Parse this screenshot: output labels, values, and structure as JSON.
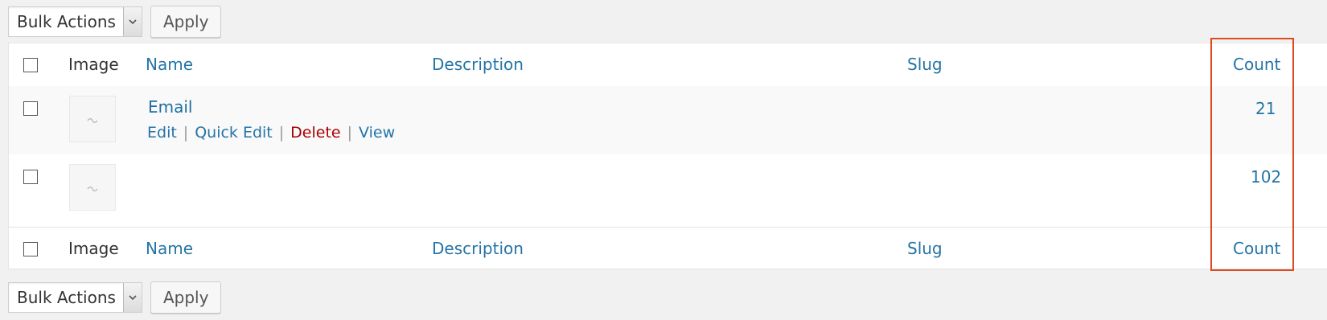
{
  "bulk_actions": {
    "select_value": "Bulk Actions",
    "apply_label": "Apply"
  },
  "columns": {
    "image": "Image",
    "name": "Name",
    "description": "Description",
    "slug": "Slug",
    "count": "Count"
  },
  "rows": [
    {
      "name": "Email",
      "description": "",
      "slug": "",
      "count": "21",
      "actions": {
        "edit": "Edit",
        "quick_edit": "Quick Edit",
        "delete": "Delete",
        "view": "View"
      }
    },
    {
      "name": "",
      "description": "",
      "slug": "",
      "count": "102"
    }
  ],
  "icons": {
    "select_arrow": "chevron-down-icon",
    "thumbnail": "image-placeholder-icon"
  },
  "colors": {
    "link": "#2474a6",
    "delete": "#aa0000",
    "highlight": "#de4a22"
  }
}
